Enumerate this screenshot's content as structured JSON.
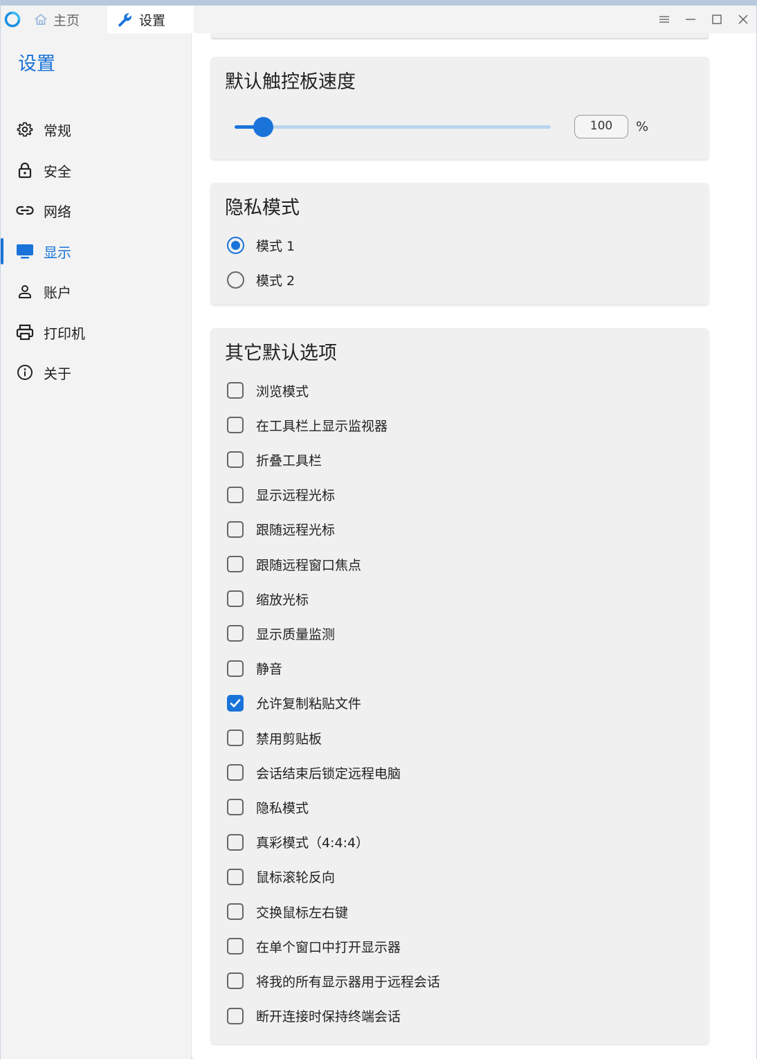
{
  "titlebar": {
    "tabs": [
      {
        "label": "主页",
        "icon": "home-icon"
      },
      {
        "label": "设置",
        "icon": "wrench-icon"
      }
    ],
    "controls": [
      "menu-icon",
      "minimize-icon",
      "maximize-icon",
      "close-icon"
    ]
  },
  "sidebar": {
    "title": "设置",
    "items": [
      {
        "label": "常规",
        "icon": "gear-icon"
      },
      {
        "label": "安全",
        "icon": "lock-icon"
      },
      {
        "label": "网络",
        "icon": "link-icon"
      },
      {
        "label": "显示",
        "icon": "monitor-icon",
        "active": true
      },
      {
        "label": "账户",
        "icon": "person-icon"
      },
      {
        "label": "打印机",
        "icon": "printer-icon"
      },
      {
        "label": "关于",
        "icon": "info-icon"
      }
    ]
  },
  "touchpad": {
    "title": "默认触控板速度",
    "value": "100",
    "unit": "%",
    "slider_fraction": 0.09
  },
  "privacy": {
    "title": "隐私模式",
    "options": [
      "模式 1",
      "模式 2"
    ],
    "selected_index": 0
  },
  "other": {
    "title": "其它默认选项",
    "options": [
      {
        "label": "浏览模式",
        "checked": false
      },
      {
        "label": "在工具栏上显示监视器",
        "checked": false
      },
      {
        "label": "折叠工具栏",
        "checked": false
      },
      {
        "label": "显示远程光标",
        "checked": false
      },
      {
        "label": "跟随远程光标",
        "checked": false
      },
      {
        "label": "跟随远程窗口焦点",
        "checked": false
      },
      {
        "label": "缩放光标",
        "checked": false
      },
      {
        "label": "显示质量监测",
        "checked": false
      },
      {
        "label": "静音",
        "checked": false
      },
      {
        "label": "允许复制粘贴文件",
        "checked": true
      },
      {
        "label": "禁用剪贴板",
        "checked": false
      },
      {
        "label": "会话结束后锁定远程电脑",
        "checked": false
      },
      {
        "label": "隐私模式",
        "checked": false
      },
      {
        "label": "真彩模式（4:4:4）",
        "checked": false
      },
      {
        "label": "鼠标滚轮反向",
        "checked": false
      },
      {
        "label": "交换鼠标左右键",
        "checked": false
      },
      {
        "label": "在单个窗口中打开显示器",
        "checked": false
      },
      {
        "label": "将我的所有显示器用于远程会话",
        "checked": false
      },
      {
        "label": "断开连接时保持终端会话",
        "checked": false
      }
    ]
  },
  "colors": {
    "accent": "#1a73d9",
    "card_bg": "#f0f0f0",
    "sidebar_bg": "#f3f3f3"
  }
}
